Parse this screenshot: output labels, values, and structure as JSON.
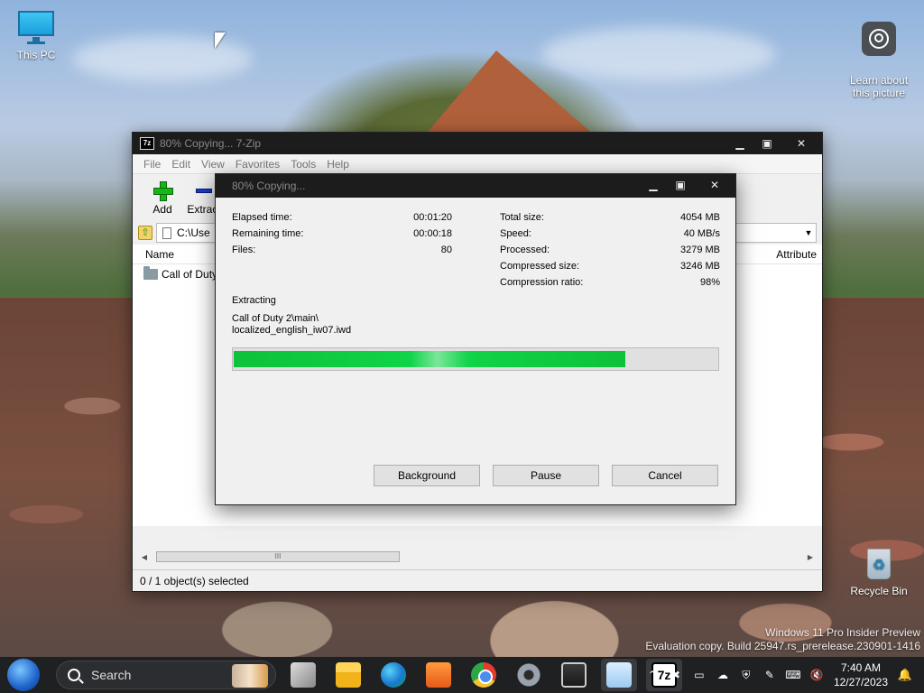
{
  "desktop": {
    "icons": [
      {
        "label": "This PC"
      },
      {
        "label": "Learn about\nthis picture"
      },
      {
        "label": "Recycle Bin"
      }
    ],
    "watermark_line1": "Windows 11 Pro Insider Preview",
    "watermark_line2": "Evaluation copy. Build 25947.rs_prerelease.230901-1416"
  },
  "main_window": {
    "title": "80% Copying... 7-Zip",
    "app_icon_text": "7z",
    "menu": [
      "File",
      "Edit",
      "View",
      "Favorites",
      "Tools",
      "Help"
    ],
    "toolbar": [
      {
        "label": "Add",
        "icon": "add-icon"
      },
      {
        "label": "Extract",
        "icon": "extract-icon"
      }
    ],
    "path": "C:\\Use",
    "columns": {
      "name": "Name",
      "attributes": "Attribute"
    },
    "rows": [
      {
        "name": "Call of Duty"
      }
    ],
    "scroll_thumb_text": "III",
    "status": "0 / 1 object(s) selected"
  },
  "progress_dialog": {
    "title": "80% Copying...",
    "left_stats": [
      {
        "key": "Elapsed time:",
        "value": "00:01:20"
      },
      {
        "key": "Remaining time:",
        "value": "00:00:18"
      },
      {
        "key": "Files:",
        "value": "80"
      }
    ],
    "right_stats": [
      {
        "key": "Total size:",
        "value": "4054 MB"
      },
      {
        "key": "Speed:",
        "value": "40 MB/s"
      },
      {
        "key": "Processed:",
        "value": "3279 MB"
      },
      {
        "key": "Compressed size:",
        "value": "3246 MB"
      },
      {
        "key": "Compression ratio:",
        "value": "98%"
      }
    ],
    "operation": "Extracting",
    "current_file_line1": "Call of Duty 2\\main\\",
    "current_file_line2": "localized_english_iw07.iwd",
    "progress_fraction": 0.809,
    "buttons": {
      "background": "Background",
      "pause": "Pause",
      "cancel": "Cancel"
    }
  },
  "taskbar": {
    "search_placeholder": "Search",
    "apps": [
      "task-view",
      "file-explorer",
      "edge",
      "media-player",
      "chrome",
      "settings",
      "remote-desktop",
      "performance-monitor",
      "7zip"
    ],
    "clock_time": "7:40 AM",
    "clock_date": "12/27/2023"
  },
  "colors": {
    "progress": "#0fd448",
    "titlebar": "#1c1c1c",
    "taskbar": "#1f2022"
  }
}
